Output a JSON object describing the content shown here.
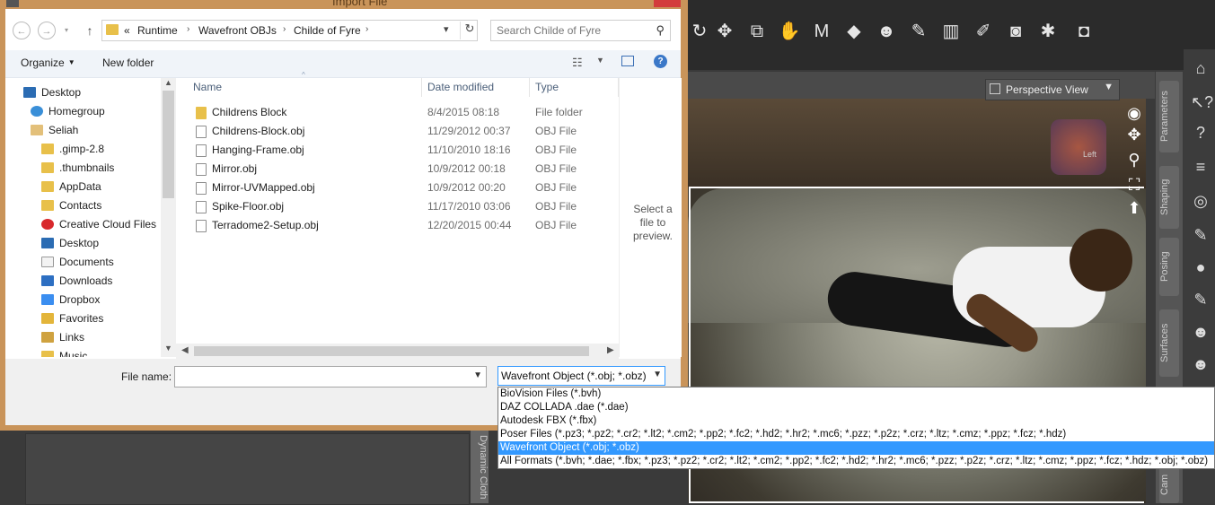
{
  "dialog": {
    "title": "Import File",
    "breadcrumbs": [
      "«",
      "Runtime",
      "Wavefront OBJs",
      "Childe of Fyre"
    ],
    "search_placeholder": "Search Childe of Fyre",
    "toolbar": {
      "organize": "Organize",
      "new_folder": "New folder"
    },
    "nav_items": [
      {
        "label": "Desktop",
        "icon": "desktop-icon"
      },
      {
        "label": "Homegroup",
        "icon": "homegroup-icon"
      },
      {
        "label": "Seliah",
        "icon": "user-folder-icon"
      },
      {
        "label": ".gimp-2.8",
        "icon": "folder-icon"
      },
      {
        "label": ".thumbnails",
        "icon": "folder-icon"
      },
      {
        "label": "AppData",
        "icon": "folder-icon"
      },
      {
        "label": "Contacts",
        "icon": "contacts-icon"
      },
      {
        "label": "Creative Cloud Files",
        "icon": "creative-cloud-icon"
      },
      {
        "label": "Desktop",
        "icon": "desktop-folder-icon"
      },
      {
        "label": "Documents",
        "icon": "documents-icon"
      },
      {
        "label": "Downloads",
        "icon": "downloads-icon"
      },
      {
        "label": "Dropbox",
        "icon": "dropbox-icon"
      },
      {
        "label": "Favorites",
        "icon": "favorites-icon"
      },
      {
        "label": "Links",
        "icon": "links-icon"
      },
      {
        "label": "Music",
        "icon": "music-icon"
      }
    ],
    "columns": {
      "name": "Name",
      "date": "Date modified",
      "type": "Type"
    },
    "files": [
      {
        "name": "Childrens Block",
        "date": "8/4/2015 08:18",
        "type": "File folder",
        "kind": "folder"
      },
      {
        "name": "Childrens-Block.obj",
        "date": "11/29/2012 00:37",
        "type": "OBJ File",
        "kind": "file"
      },
      {
        "name": "Hanging-Frame.obj",
        "date": "11/10/2010 18:16",
        "type": "OBJ File",
        "kind": "file"
      },
      {
        "name": "Mirror.obj",
        "date": "10/9/2012 00:18",
        "type": "OBJ File",
        "kind": "file"
      },
      {
        "name": "Mirror-UVMapped.obj",
        "date": "10/9/2012 00:20",
        "type": "OBJ File",
        "kind": "file"
      },
      {
        "name": "Spike-Floor.obj",
        "date": "11/17/2010 03:06",
        "type": "OBJ File",
        "kind": "file"
      },
      {
        "name": "Terradome2-Setup.obj",
        "date": "12/20/2015 00:44",
        "type": "OBJ File",
        "kind": "file"
      }
    ],
    "preview_text": "Select a file to preview.",
    "file_name_label": "File name:",
    "file_name_value": "",
    "file_type_selected": "Wavefront Object (*.obj; *.obz)",
    "file_type_options": [
      "BioVision Files (*.bvh)",
      "DAZ COLLADA .dae (*.dae)",
      "Autodesk FBX (*.fbx)",
      "Poser Files (*.pz3; *.pz2; *.cr2; *.lt2; *.cm2; *.pp2; *.fc2; *.hd2; *.hr2; *.mc6; *.pzz; *.p2z; *.crz; *.ltz; *.cmz; *.ppz; *.fcz; *.hdz)",
      "Wavefront Object (*.obj; *.obz)",
      "All Formats (*.bvh; *.dae; *.fbx; *.pz3; *.pz2; *.cr2; *.lt2; *.cm2; *.pp2; *.fc2; *.hd2; *.hr2; *.mc6; *.pzz; *.p2z; *.crz; *.ltz; *.cmz; *.ppz; *.fcz; *.hdz; *.obj; *.obz)"
    ],
    "selected_option_index": 4
  },
  "viewport": {
    "camera_label": "Perspective View",
    "cube_face": "Left",
    "right_tabs": [
      "Parameters",
      "Shaping",
      "Posing",
      "Surfaces",
      "Cam"
    ],
    "bottom_tab": "Dynamic Cloth"
  },
  "colors": {
    "accent": "#3399ff",
    "dialog_frame": "#c9945a",
    "app_bg": "#3a3a3a"
  }
}
